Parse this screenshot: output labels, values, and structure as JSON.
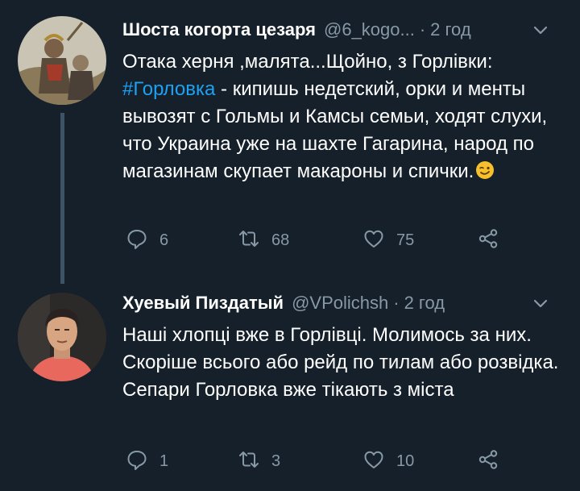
{
  "tweets": [
    {
      "name": "Шоста когорта цезаря",
      "handle": "@6_kogo...",
      "separator": "·",
      "time": "2 год",
      "text_before": "Отака херня ,малята...Щойно, з Горлівки: ",
      "hashtag": "#Горловка",
      "text_after": " - кипишь недетский, орки и менты вывозят с Гольмы и Камсы семьи, ходят слухи, что Украина уже на шахте Гагарина, народ по магазинам скупает макароны и спички.",
      "emoji": "winking-face",
      "replies": "6",
      "retweets": "68",
      "likes": "75"
    },
    {
      "name": "Хуевый Пиздатый",
      "handle": "@VPolichsh",
      "separator": "·",
      "time": "2 год",
      "text": "Наші хлопці вже в Горлівці. Молимось за них. Скоріше всього або рейд по тилам або розвідка. Сепари Горловка вже тікають з міста",
      "replies": "1",
      "retweets": "3",
      "likes": "10"
    }
  ],
  "colors": {
    "background": "#15202b",
    "text": "#ffffff",
    "secondary": "#8899a6",
    "link": "#1da1f2",
    "thread_line": "#3d5466"
  },
  "icons": [
    "reply-icon",
    "retweet-icon",
    "like-icon",
    "share-icon",
    "chevron-down-icon"
  ]
}
